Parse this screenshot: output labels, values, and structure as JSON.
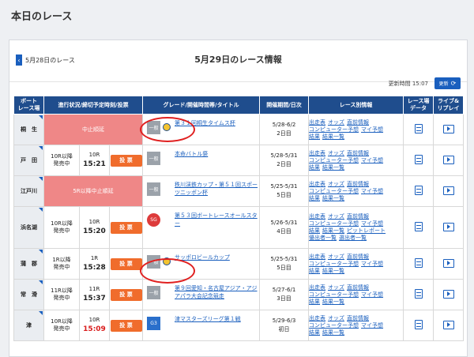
{
  "header": {
    "title": "本日のレース"
  },
  "nav": {
    "prev_label": "5月28日のレース",
    "prev_arrow": "‹",
    "title": "5月29日のレース情報"
  },
  "update": {
    "time_text": "更新時間 15:07",
    "button_label": "更新",
    "refresh_icon": "⟳"
  },
  "columns": {
    "venue": "ボート\nレース場",
    "status": "進行状況/締切予定時刻/投票",
    "grade": "グレード/開催時間帯/タイトル",
    "period": "開催期間/日次",
    "info": "レース別情報",
    "data": "レース場\nデータ",
    "live": "ライブ&\nリプレイ"
  },
  "rows": [
    {
      "venue": "桐　生",
      "status_banner": "中止順延",
      "grade": "一般",
      "grade_type": "ippan",
      "night": true,
      "title": "第３１回桐生タイムス杯",
      "period": "5/28-6/2",
      "day": "2日目",
      "info": [
        "出走表",
        "オッズ",
        "直前情報",
        "コンピューター予想",
        "マイ予想",
        "結果",
        "結果一覧"
      ]
    },
    {
      "venue": "戸　田",
      "sales": "10R以降\n発売中",
      "race": "10R",
      "deadline": "15:21",
      "vote": "投 票",
      "grade": "一般",
      "grade_type": "ippan",
      "night": false,
      "title": "本命バトル祭",
      "period": "5/28-5/31",
      "day": "2日目",
      "info": [
        "出走表",
        "オッズ",
        "直前情報",
        "コンピューター予想",
        "マイ予想",
        "結果",
        "結果一覧"
      ]
    },
    {
      "venue": "江戸川",
      "status_banner": "5R以降中止順延",
      "grade": "一般",
      "grade_type": "ippan",
      "night": false,
      "title": "秩川渓鉄カップ・第５１回スポーツニッポン杯",
      "period": "5/25-5/31",
      "day": "5日目",
      "info": [
        "出走表",
        "オッズ",
        "直前情報",
        "コンピューター予想",
        "マイ予想",
        "結果",
        "結果一覧"
      ]
    },
    {
      "venue": "浜名湖",
      "sales": "10R以降\n発売中",
      "race": "10R",
      "deadline": "15:20",
      "vote": "投 票",
      "grade": "SG",
      "grade_type": "sg",
      "night": false,
      "title": "第５３回ボートレースオールスター",
      "period": "5/26-5/31",
      "day": "4日目",
      "info": [
        "出走表",
        "オッズ",
        "直前情報",
        "コンピューター予想",
        "マイ予想",
        "結果",
        "結果一覧",
        "ピットレポート",
        "優出者一覧",
        "選出者一覧"
      ]
    },
    {
      "venue": "蒲　郡",
      "sales": "1R以降\n発売中",
      "race": "1R",
      "deadline": "15:28",
      "vote": "投 票",
      "grade": "一般",
      "grade_type": "ippan",
      "night": true,
      "title": "サッポロビールカップ",
      "period": "5/25-5/31",
      "day": "5日目",
      "info": [
        "出走表",
        "オッズ",
        "直前情報",
        "コンピューター予想",
        "マイ予想",
        "結果",
        "結果一覧"
      ]
    },
    {
      "venue": "常　滑",
      "sales": "11R以降\n発売中",
      "race": "11R",
      "deadline": "15:37",
      "vote": "投 票",
      "grade": "一般",
      "grade_type": "ippan",
      "night": false,
      "title": "第９回愛知・名古屋アジア・アジアパラ大会記念競走",
      "period": "5/27-6/1",
      "day": "3日目",
      "info": [
        "出走表",
        "オッズ",
        "直前情報",
        "コンピューター予想",
        "マイ予想",
        "結果",
        "結果一覧"
      ]
    },
    {
      "venue": "津",
      "sales": "10R以降\n発売中",
      "race": "10R",
      "deadline": "15:09",
      "deadline_urgent": true,
      "vote": "投 票",
      "grade": "G3",
      "grade_type": "g3",
      "night": false,
      "title": "津マスターズリーグ第１戦",
      "period": "5/29-6/3",
      "day": "初日",
      "info": [
        "出走表",
        "オッズ",
        "直前情報",
        "コンピューター予想",
        "マイ予想",
        "結果",
        "結果一覧"
      ]
    }
  ],
  "icons": {
    "data": "document-icon",
    "live": "play-icon",
    "night": "night-moon-icon"
  },
  "colors": {
    "header_bg": "#1f4d8d",
    "vote_btn": "#f06c2c",
    "cancel_banner": "#ef8787",
    "link": "#1a5fbe",
    "annotation": "#e02020"
  }
}
